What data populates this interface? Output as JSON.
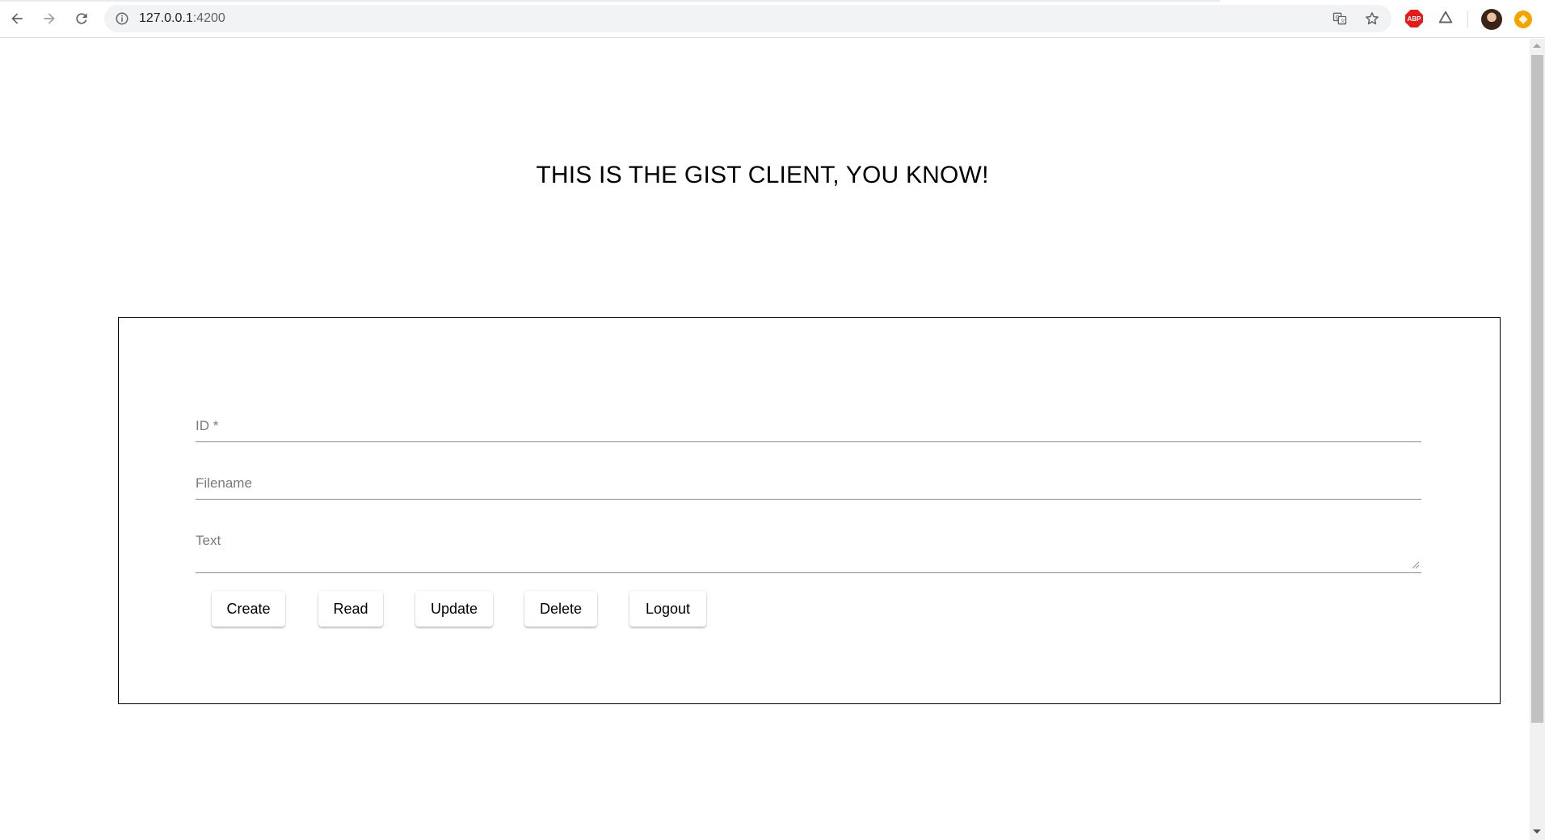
{
  "browser": {
    "url_host": "127.0.0.1",
    "url_port": ":4200",
    "extensions": {
      "abp_label": "ABP"
    }
  },
  "page": {
    "title": "THIS IS THE GIST CLIENT, YOU KNOW!"
  },
  "form": {
    "id_label": "ID *",
    "filename_label": "Filename",
    "text_label": "Text",
    "buttons": {
      "create": "Create",
      "read": "Read",
      "update": "Update",
      "delete": "Delete",
      "logout": "Logout"
    }
  }
}
